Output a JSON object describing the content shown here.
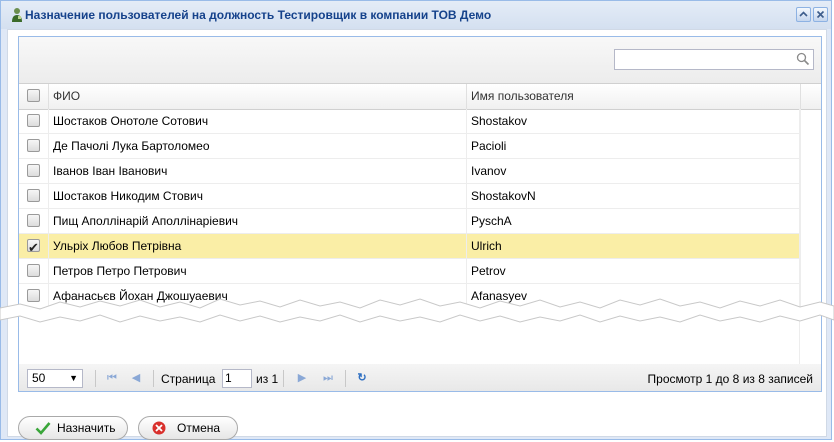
{
  "window": {
    "title": "Назначение пользователей на должность Тестировщик в компании ТОВ Демо",
    "accent_color": "#15428b",
    "border_color": "#99bbe8",
    "title_icon": "user-assign-icon",
    "collapse_icon": "collapse-icon",
    "close_icon": "close-icon"
  },
  "grid": {
    "search": {
      "placeholder": "",
      "icon": "search-icon"
    },
    "columns": {
      "fio": "ФИО",
      "username": "Имя пользователя"
    },
    "selected_row_color": "#faeea6",
    "rows": [
      {
        "fio": "Шостаков Онотоле Сотович",
        "username": "Shostakov",
        "checked": false
      },
      {
        "fio": "Де Пачолі Лука Бартоломео",
        "username": "Pacioli",
        "checked": false
      },
      {
        "fio": "Іванов Іван Іванович",
        "username": "Ivanov",
        "checked": false
      },
      {
        "fio": "Шостаков Никодим Стович",
        "username": "ShostakovN",
        "checked": false
      },
      {
        "fio": "Пищ Аполлінарій Аполлінаріевич",
        "username": "PyschA",
        "checked": false
      },
      {
        "fio": "Ульріх Любов Петрівна",
        "username": "Ulrich",
        "checked": true
      },
      {
        "fio": "Петров Петро Петрович",
        "username": "Petrov",
        "checked": false
      },
      {
        "fio": "Афанасьєв Йохан Джошуаевич",
        "username": "Afanasyev",
        "checked": false
      }
    ]
  },
  "pager": {
    "page_size": "50",
    "page_label": "Страница",
    "page_value": "1",
    "of_label": "из 1",
    "display_info": "Просмотр 1 до 8 из 8 записей",
    "icons": [
      "first-page-icon",
      "prev-page-icon",
      "next-page-icon",
      "last-page-icon",
      "refresh-icon"
    ]
  },
  "buttons": {
    "assign": {
      "label": "Назначить",
      "icon": "check-icon",
      "icon_color": "#3aa63a"
    },
    "cancel": {
      "label": "Отмена",
      "icon": "cancel-icon",
      "icon_color": "#d9302c"
    }
  }
}
